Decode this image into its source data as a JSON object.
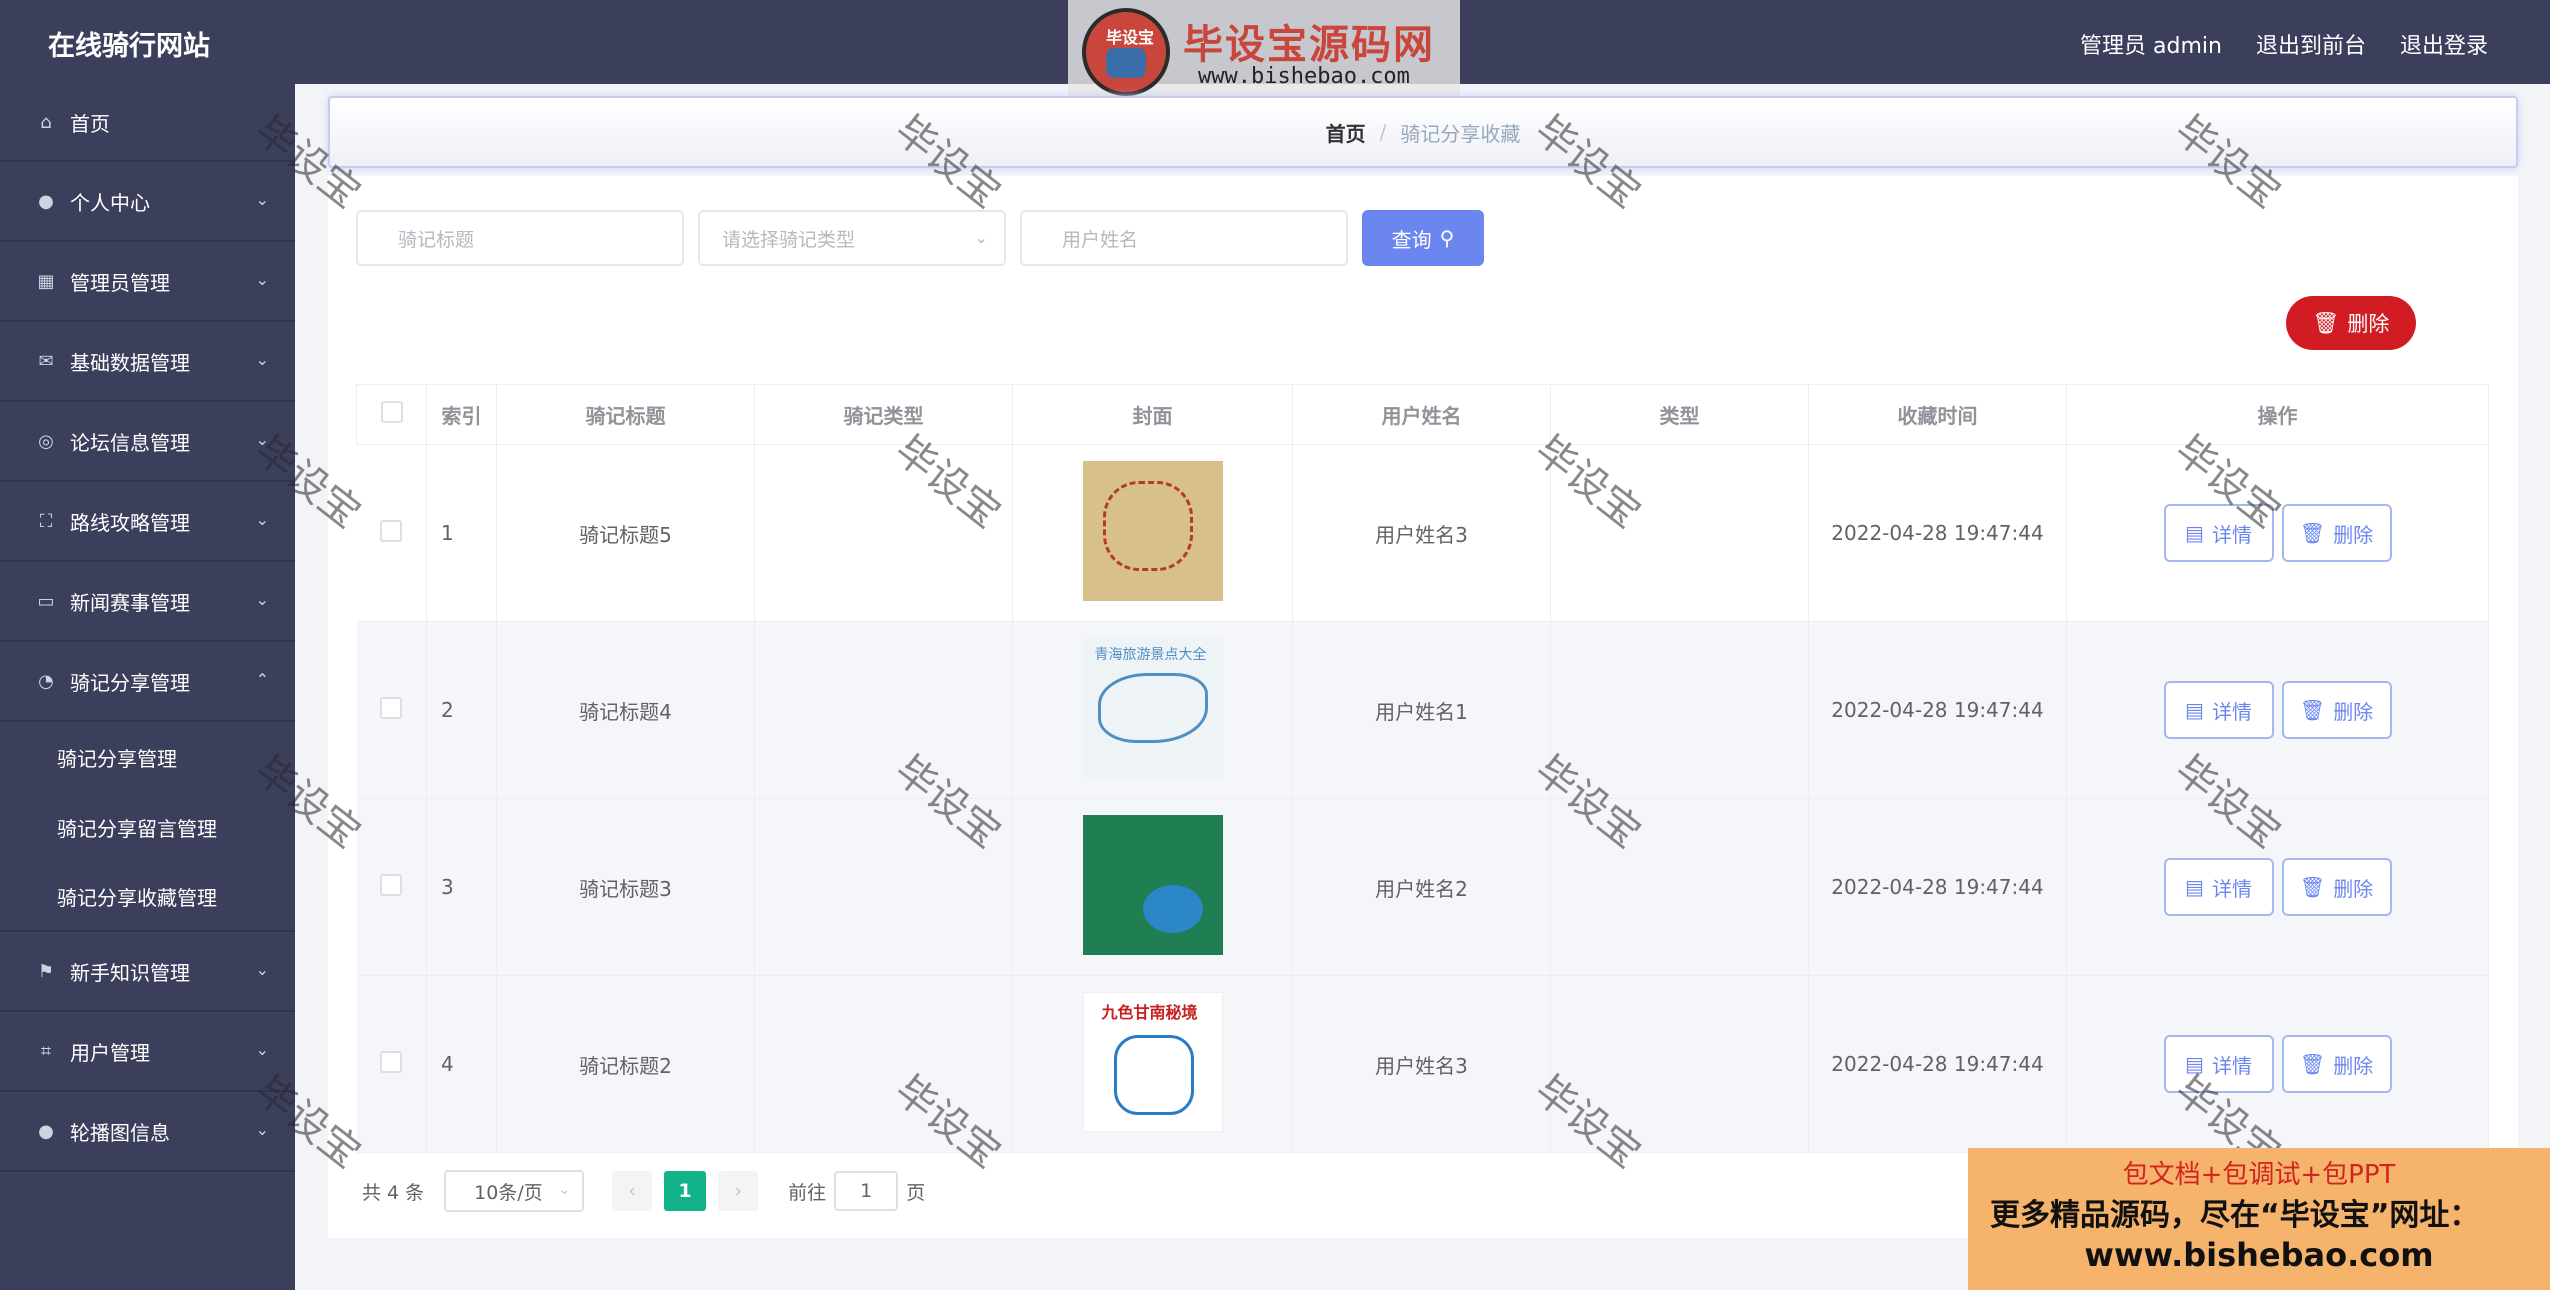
{
  "header": {
    "site_title": "在线骑行网站",
    "user_label": "管理员 admin",
    "back_front": "退出到前台",
    "logout": "退出登录"
  },
  "top_logo": {
    "badge": "毕设宝",
    "brand": "毕设宝源码网",
    "url": "www.bishebao.com"
  },
  "sidebar": {
    "items": [
      {
        "label": "首页",
        "icon": "home-icon"
      },
      {
        "label": "个人中心",
        "icon": "user-icon"
      },
      {
        "label": "管理员管理",
        "icon": "grid-icon"
      },
      {
        "label": "基础数据管理",
        "icon": "mail-icon"
      },
      {
        "label": "论坛信息管理",
        "icon": "compass-icon"
      },
      {
        "label": "路线攻略管理",
        "icon": "scan-icon"
      },
      {
        "label": "新闻赛事管理",
        "icon": "message-icon"
      },
      {
        "label": "骑记分享管理",
        "icon": "gauge-icon"
      },
      {
        "label": "新手知识管理",
        "icon": "flag-icon"
      },
      {
        "label": "用户管理",
        "icon": "crop-icon"
      },
      {
        "label": "轮播图信息",
        "icon": "user-icon"
      }
    ],
    "sub_items": [
      "骑记分享管理",
      "骑记分享留言管理",
      "骑记分享收藏管理"
    ]
  },
  "breadcrumb": {
    "home": "首页",
    "sep": "/",
    "current": "骑记分享收藏"
  },
  "search": {
    "title_placeholder": "骑记标题",
    "type_placeholder": "请选择骑记类型",
    "username_placeholder": "用户姓名",
    "query_label": "查询"
  },
  "toolbar": {
    "delete_label": "删除"
  },
  "table": {
    "headers": [
      "索引",
      "骑记标题",
      "骑记类型",
      "封面",
      "用户姓名",
      "类型",
      "收藏时间",
      "操作"
    ],
    "rows": [
      {
        "index": "1",
        "title": "骑记标题5",
        "ride_type": "",
        "user": "用户姓名3",
        "type": "",
        "time": "2022-04-28 19:47:44"
      },
      {
        "index": "2",
        "title": "骑记标题4",
        "ride_type": "",
        "user": "用户姓名1",
        "type": "",
        "time": "2022-04-28 19:47:44"
      },
      {
        "index": "3",
        "title": "骑记标题3",
        "ride_type": "",
        "user": "用户姓名2",
        "type": "",
        "time": "2022-04-28 19:47:44"
      },
      {
        "index": "4",
        "title": "骑记标题2",
        "ride_type": "",
        "user": "用户姓名3",
        "type": "",
        "time": "2022-04-28 19:47:44"
      }
    ],
    "detail_label": "详情",
    "delete_label": "删除",
    "cover2_text": "青海旅游景点大全",
    "cover4_text": "九色甘南秘境"
  },
  "pager": {
    "total": "共 4 条",
    "page_size": "10条/页",
    "current_page": "1",
    "goto_prefix": "前往",
    "goto_value": "1",
    "goto_suffix": "页"
  },
  "watermark": "毕设宝",
  "ad": {
    "line1": "包文档+包调试+包PPT",
    "line2": "更多精品源码，尽在“毕设宝”网址：",
    "line3": "www.bishebao.com"
  },
  "colors": {
    "sidebar_bg": "#3b3f5c",
    "primary": "#6c86f0",
    "danger": "#d21c23",
    "pager_active": "#12b38a"
  }
}
